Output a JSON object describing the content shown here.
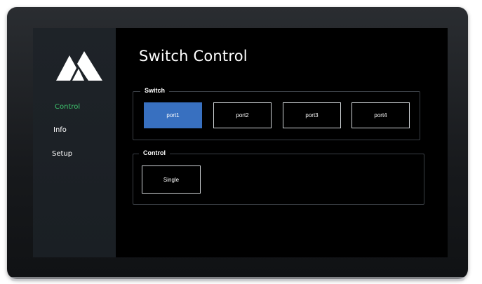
{
  "logo": {
    "icon": "brand-logo-icon"
  },
  "sidebar": {
    "items": [
      {
        "label": "Control",
        "active": true
      },
      {
        "label": "Info",
        "active": false
      },
      {
        "label": "Setup",
        "active": false
      }
    ]
  },
  "main": {
    "title": "Switch Control",
    "switch_group": {
      "legend": "Switch",
      "ports": [
        {
          "label": "port1",
          "active": true
        },
        {
          "label": "port2",
          "active": false
        },
        {
          "label": "port3",
          "active": false
        },
        {
          "label": "port4",
          "active": false
        }
      ]
    },
    "control_group": {
      "legend": "Control",
      "button_label": "Single"
    }
  },
  "colors": {
    "accent_active_nav": "#3ec46d",
    "port_active": "#3870c0",
    "screen_bg": "#000000",
    "sidebar_bg": "#1e2328"
  }
}
